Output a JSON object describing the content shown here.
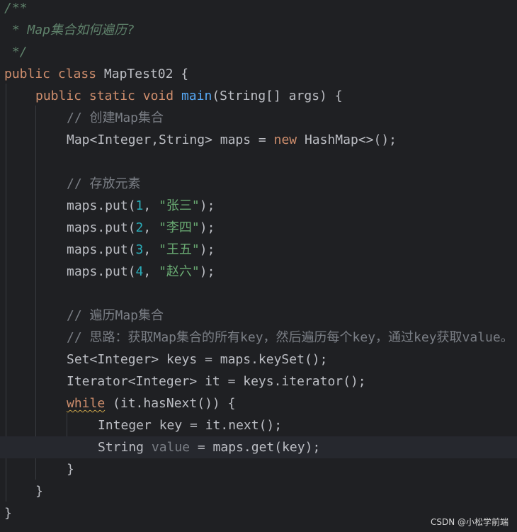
{
  "code": {
    "doc_open": "/**",
    "doc_line": " * Map集合如何遍历?",
    "doc_close": " */",
    "class_decl": {
      "kw1": "public",
      "kw2": "class",
      "name": "MapTest02",
      "brace": " {"
    },
    "main_decl": {
      "kw1": "public",
      "kw2": "static",
      "kw3": "void",
      "fn": "main",
      "params": "(String[] args) {"
    },
    "comment_create": "// 创建Map集合",
    "map_decl": {
      "pre": "Map<Integer,String> maps = ",
      "kw": "new",
      "post": " HashMap<>();"
    },
    "comment_store": "// 存放元素",
    "puts": [
      {
        "prefix": "maps.put(",
        "num": "1",
        "sep": ", ",
        "str": "\"张三\"",
        "suffix": ");"
      },
      {
        "prefix": "maps.put(",
        "num": "2",
        "sep": ", ",
        "str": "\"李四\"",
        "suffix": ");"
      },
      {
        "prefix": "maps.put(",
        "num": "3",
        "sep": ", ",
        "str": "\"王五\"",
        "suffix": ");"
      },
      {
        "prefix": "maps.put(",
        "num": "4",
        "sep": ", ",
        "str": "\"赵六\"",
        "suffix": ");"
      }
    ],
    "comment_iterate": "// 遍历Map集合",
    "comment_idea": "// 思路：获取Map集合的所有key，然后遍历每个key，通过key获取value。",
    "keyset_line": "Set<Integer> keys = maps.keySet();",
    "iterator_line": "Iterator<Integer> it = keys.iterator();",
    "while_line": {
      "kw": "while",
      "rest": " (it.hasNext()) {"
    },
    "next_line": "Integer key = it.next();",
    "get_line": {
      "pre": "String ",
      "var": "value",
      "post": " = maps.get(key);"
    },
    "close_while": "}",
    "close_main": "}",
    "close_class": "}"
  },
  "watermark": "CSDN @小松学前端",
  "colors": {
    "background": "#1f2023",
    "current_line": "#26282e",
    "keyword": "#cf8e6d",
    "function": "#56a8f5",
    "number": "#2aacb8",
    "string": "#6aab73",
    "comment": "#7a7e85",
    "doc_comment": "#5f826b",
    "text": "#bcbec4"
  }
}
